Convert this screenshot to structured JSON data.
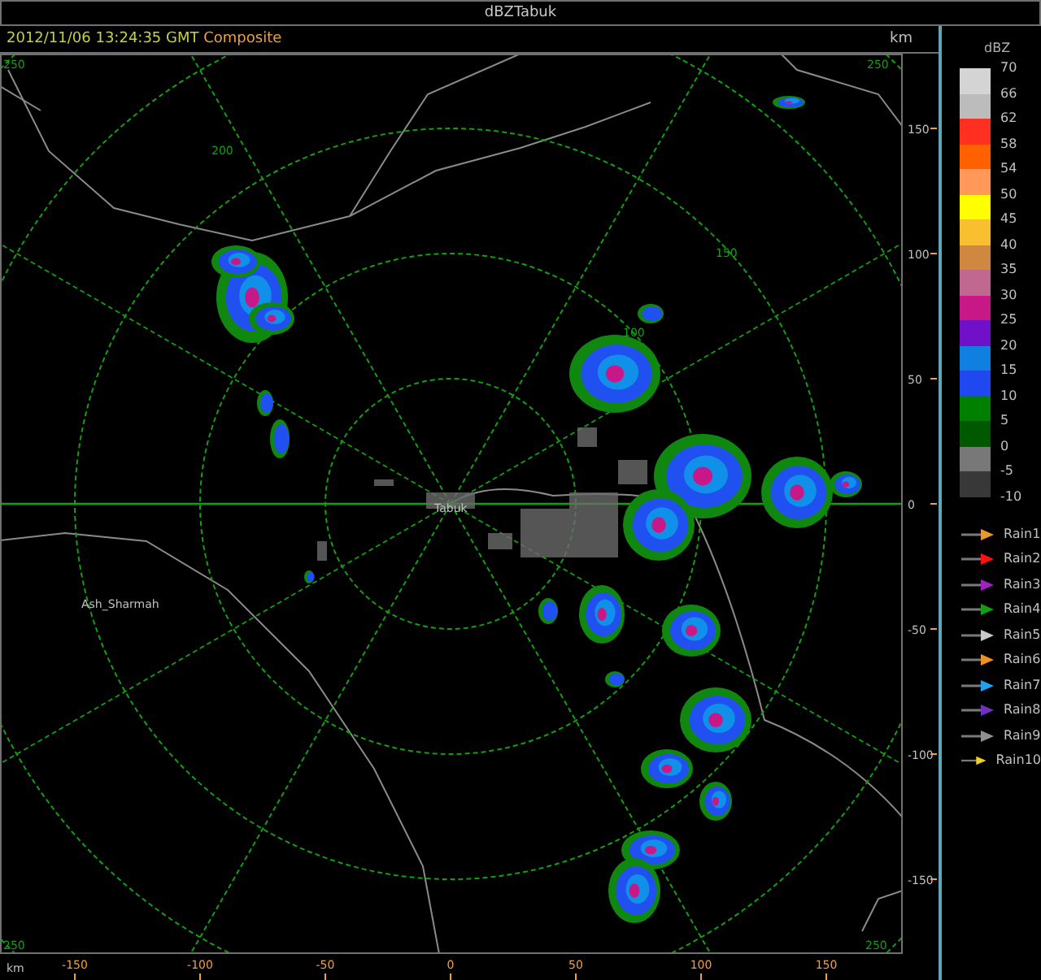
{
  "window": {
    "title": "dBZTabuk"
  },
  "header": {
    "timestamp": "2012/11/06 13:24:35 GMT",
    "product": "Composite",
    "unit": "km"
  },
  "map": {
    "places": [
      "Tabuk",
      "Ash_Sharmah"
    ],
    "ring_labels": [
      "250",
      "250",
      "200",
      "150",
      "100",
      "250",
      "250"
    ]
  },
  "y_axis": {
    "ticks": [
      "150",
      "100",
      "50",
      "0",
      "-50",
      "-100",
      "-150"
    ]
  },
  "x_axis": {
    "unit": "km",
    "ticks": [
      "-150",
      "-100",
      "-50",
      "0",
      "50",
      "100",
      "150"
    ]
  },
  "legend": {
    "title": "dBZ",
    "bottom_label": "-10",
    "bins": [
      {
        "label": "70",
        "color": "#d4d4d4"
      },
      {
        "label": "66",
        "color": "#bcbcbc"
      },
      {
        "label": "62",
        "color": "#ff3020"
      },
      {
        "label": "58",
        "color": "#ff6000"
      },
      {
        "label": "54",
        "color": "#ff9858"
      },
      {
        "label": "50",
        "color": "#ffff00"
      },
      {
        "label": "45",
        "color": "#f8c030"
      },
      {
        "label": "40",
        "color": "#d08840"
      },
      {
        "label": "35",
        "color": "#c06890"
      },
      {
        "label": "30",
        "color": "#c81888"
      },
      {
        "label": "25",
        "color": "#7010c8"
      },
      {
        "label": "20",
        "color": "#1080e0"
      },
      {
        "label": "15",
        "color": "#2048f0"
      },
      {
        "label": "10",
        "color": "#008000"
      },
      {
        "label": "5",
        "color": "#005800"
      },
      {
        "label": "0",
        "color": "#787878"
      },
      {
        "label": "-5",
        "color": "#383838"
      }
    ],
    "tracks": [
      {
        "label": "Rain1",
        "color": "#e89a28"
      },
      {
        "label": "Rain2",
        "color": "#ff1010"
      },
      {
        "label": "Rain3",
        "color": "#a020c0"
      },
      {
        "label": "Rain4",
        "color": "#10a010"
      },
      {
        "label": "Rain5",
        "color": "#c8c8c8"
      },
      {
        "label": "Rain6",
        "color": "#f09020"
      },
      {
        "label": "Rain7",
        "color": "#20a0f0"
      },
      {
        "label": "Rain8",
        "color": "#7030c0"
      },
      {
        "label": "Rain9",
        "color": "#909090"
      },
      {
        "label": "Rain10",
        "color": "#f0d020"
      }
    ]
  }
}
